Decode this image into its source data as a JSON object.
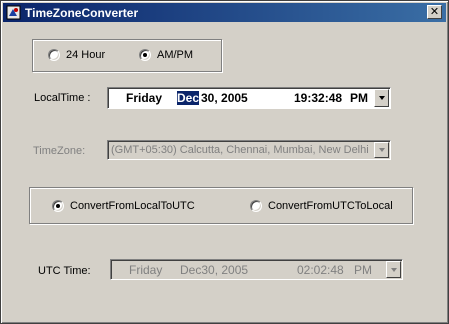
{
  "window": {
    "title": "TimeZoneConverter",
    "close_symbol": "✕"
  },
  "format": {
    "option_24h": "24 Hour",
    "option_ampm": "AM/PM",
    "selected": "AM/PM"
  },
  "local_time": {
    "label": "LocalTime :",
    "weekday": "Friday",
    "month": "Dec",
    "date_rest": "30, 2005",
    "time": "19:32:48",
    "ampm": "PM"
  },
  "timezone": {
    "label": "TimeZone:",
    "value": "(GMT+05:30) Calcutta, Chennai, Mumbai, New Delhi"
  },
  "direction": {
    "option_local_to_utc": "ConvertFromLocalToUTC",
    "option_utc_to_local": "ConvertFromUTCToLocal",
    "selected": "ConvertFromLocalToUTC"
  },
  "utc_time": {
    "label": "UTC Time:",
    "weekday": "Friday",
    "date": "Dec30, 2005",
    "time": "02:02:48",
    "ampm": "PM"
  },
  "icons": {
    "title_icon": "app-icon",
    "dropdown_icon": "chevron-down-icon"
  }
}
